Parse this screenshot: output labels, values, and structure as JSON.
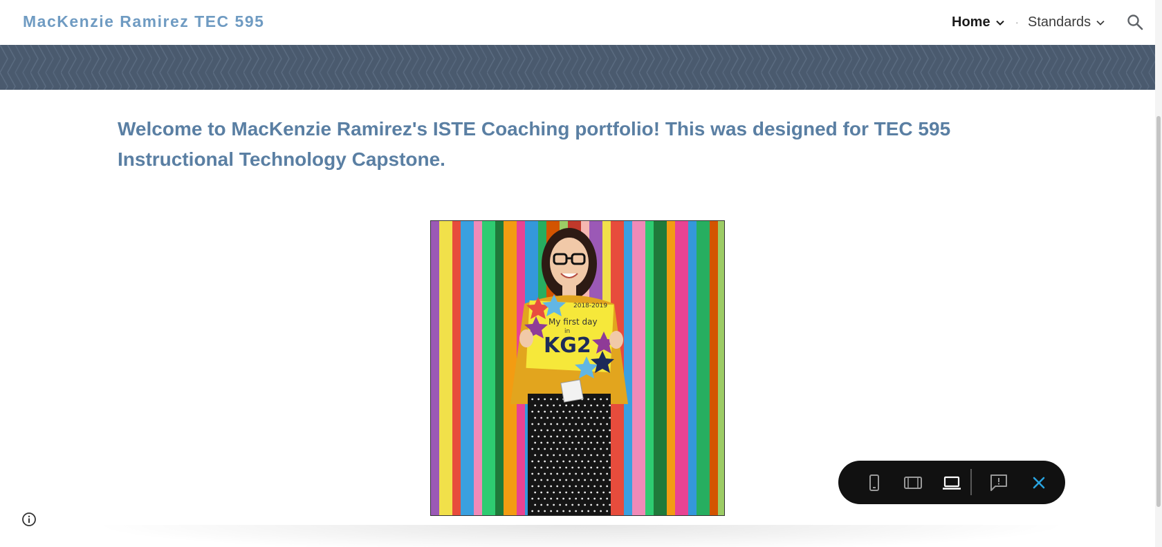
{
  "header": {
    "site_title": "MacKenzie Ramirez TEC 595",
    "nav": [
      {
        "label": "Home",
        "active": true
      },
      {
        "label": "Standards",
        "active": false
      }
    ],
    "nav_separator": "·"
  },
  "main": {
    "welcome_text": "Welcome to MacKenzie Ramirez's ISTE Coaching portfolio! This was designed for TEC 595 Instructional Technology Capstone."
  },
  "photo": {
    "sign_year": "2018-2019",
    "sign_line1": "My first day",
    "sign_line2": "in",
    "sign_line3": "KG2"
  },
  "toolbar": {
    "icons": [
      "phone-icon",
      "tablet-icon",
      "laptop-icon",
      "feedback-icon",
      "close-icon"
    ],
    "active_icon": "laptop-icon"
  },
  "colors": {
    "title": "#6f9bc2",
    "welcome": "#5a7fa3",
    "banner": "#4a5a6e",
    "toolbar": "#111111",
    "close_accent": "#29a3e0"
  }
}
